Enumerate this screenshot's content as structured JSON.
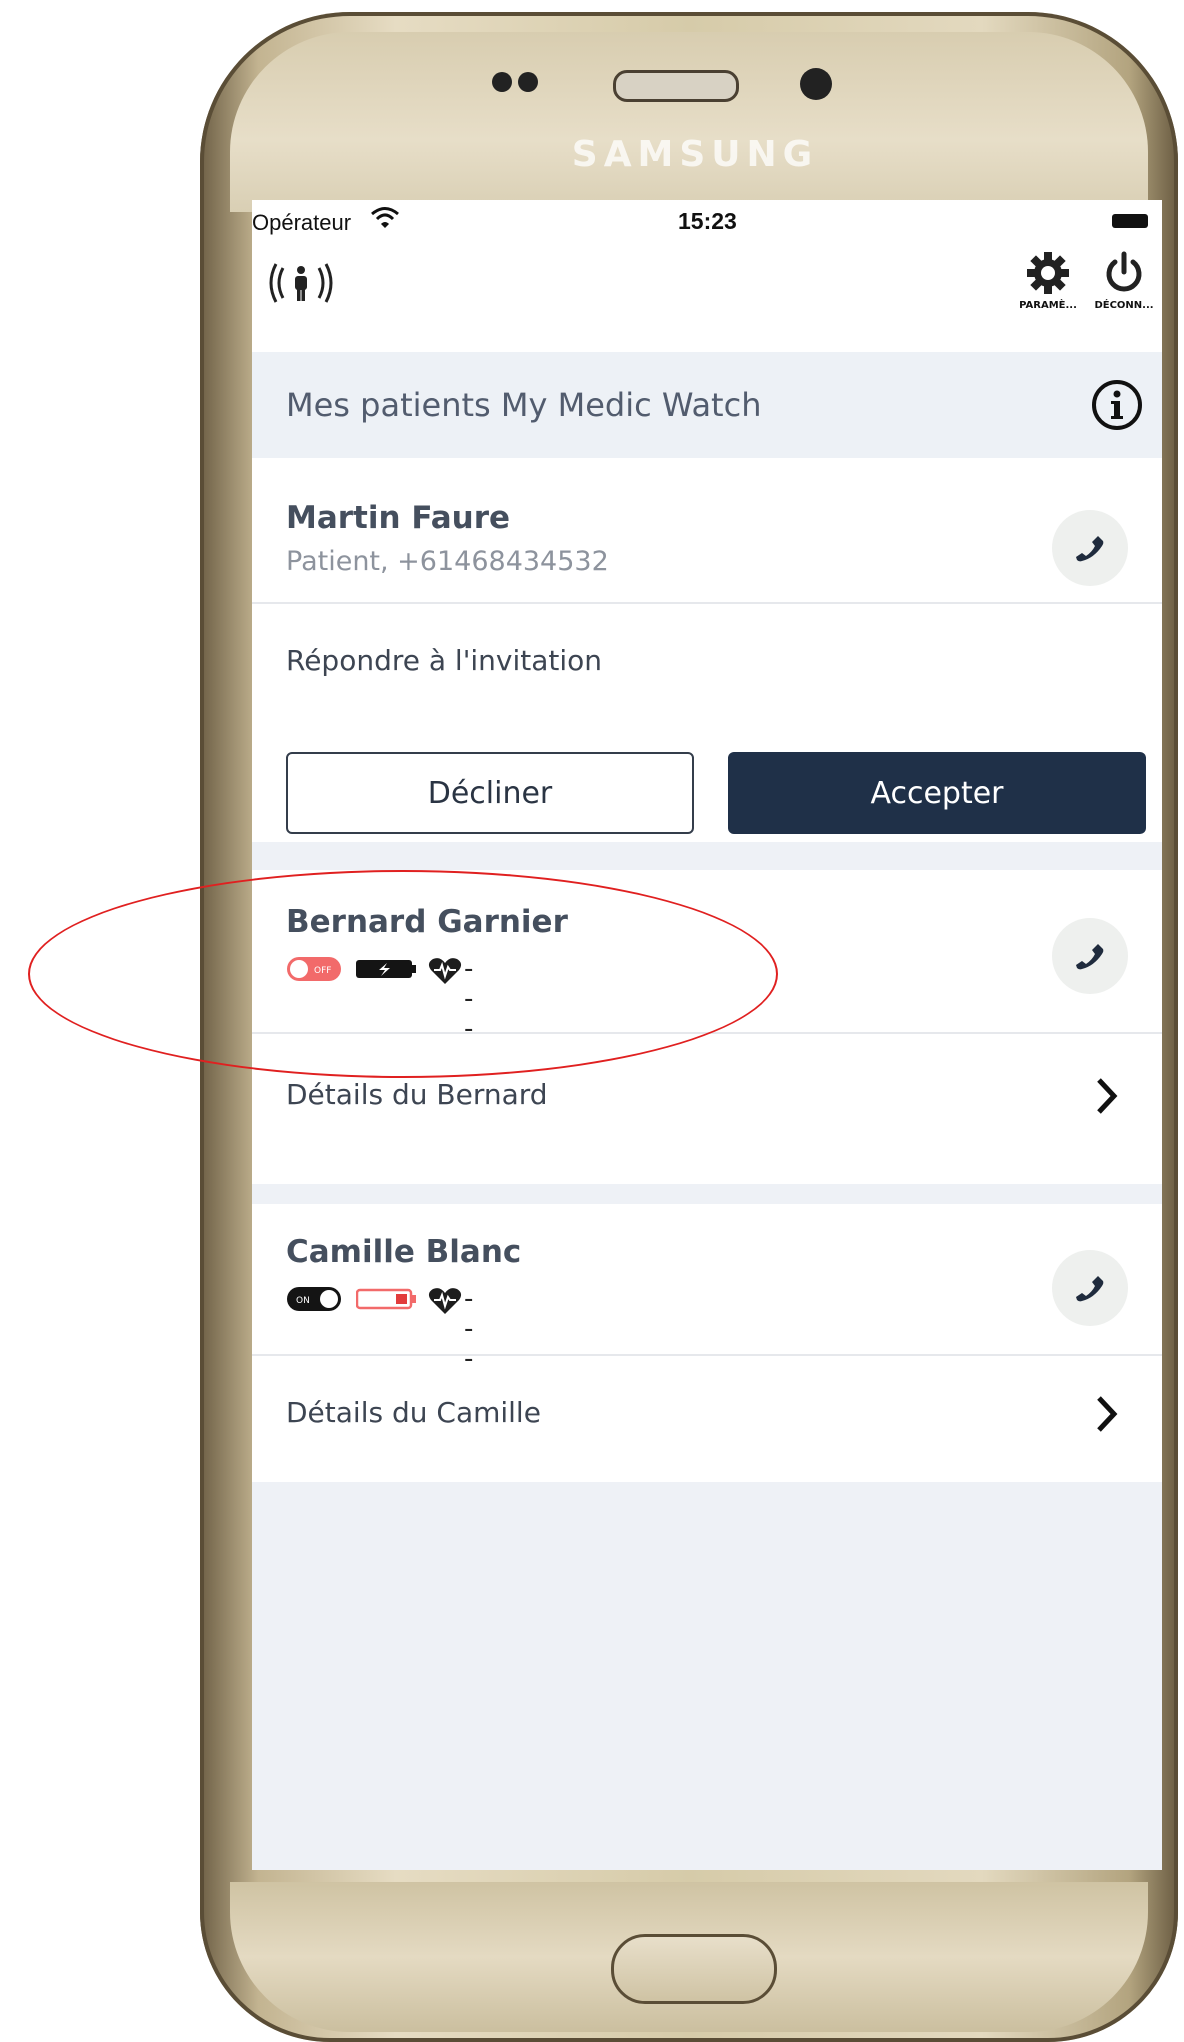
{
  "device": {
    "brand": "SAMSUNG"
  },
  "status_bar": {
    "carrier": "Opérateur",
    "time": "15:23"
  },
  "app_bar": {
    "settings_label": "PARAMÈ...",
    "logout_label": "DÉCONN..."
  },
  "section": {
    "title": "Mes patients My Medic Watch"
  },
  "patients": [
    {
      "name": "Martin Faure",
      "subtitle": "Patient, +61468434532",
      "invitation_prompt": "Répondre à l'invitation",
      "decline_label": "Décliner",
      "accept_label": "Accepter"
    },
    {
      "name": "Bernard Garnier",
      "switch_label": "OFF",
      "watch_status": "off",
      "battery_status": "charging",
      "heart_rate": "---",
      "details_label": "Détails du Bernard"
    },
    {
      "name": "Camille Blanc",
      "switch_label": "ON",
      "watch_status": "on",
      "battery_status": "low",
      "heart_rate": "---",
      "details_label": "Détails du Camille"
    }
  ],
  "colors": {
    "accent_dark": "#1f3048",
    "off_red": "#f26a6a",
    "annotation_red": "#e02020"
  }
}
